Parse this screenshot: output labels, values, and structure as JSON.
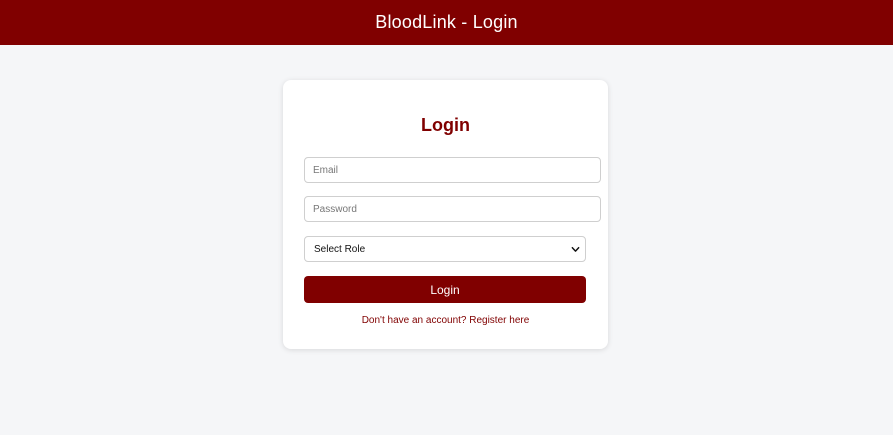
{
  "header": {
    "title": "BloodLink - Login"
  },
  "login_card": {
    "title": "Login",
    "email": {
      "placeholder": "Email",
      "value": ""
    },
    "password": {
      "placeholder": "Password",
      "value": ""
    },
    "role_select": {
      "selected": "Select Role",
      "icon": "chevron-down-icon"
    },
    "submit_label": "Login",
    "register_link": "Don't have an account? Register here"
  },
  "colors": {
    "brand": "#800000",
    "background": "#f5f6f8",
    "card": "#ffffff"
  }
}
